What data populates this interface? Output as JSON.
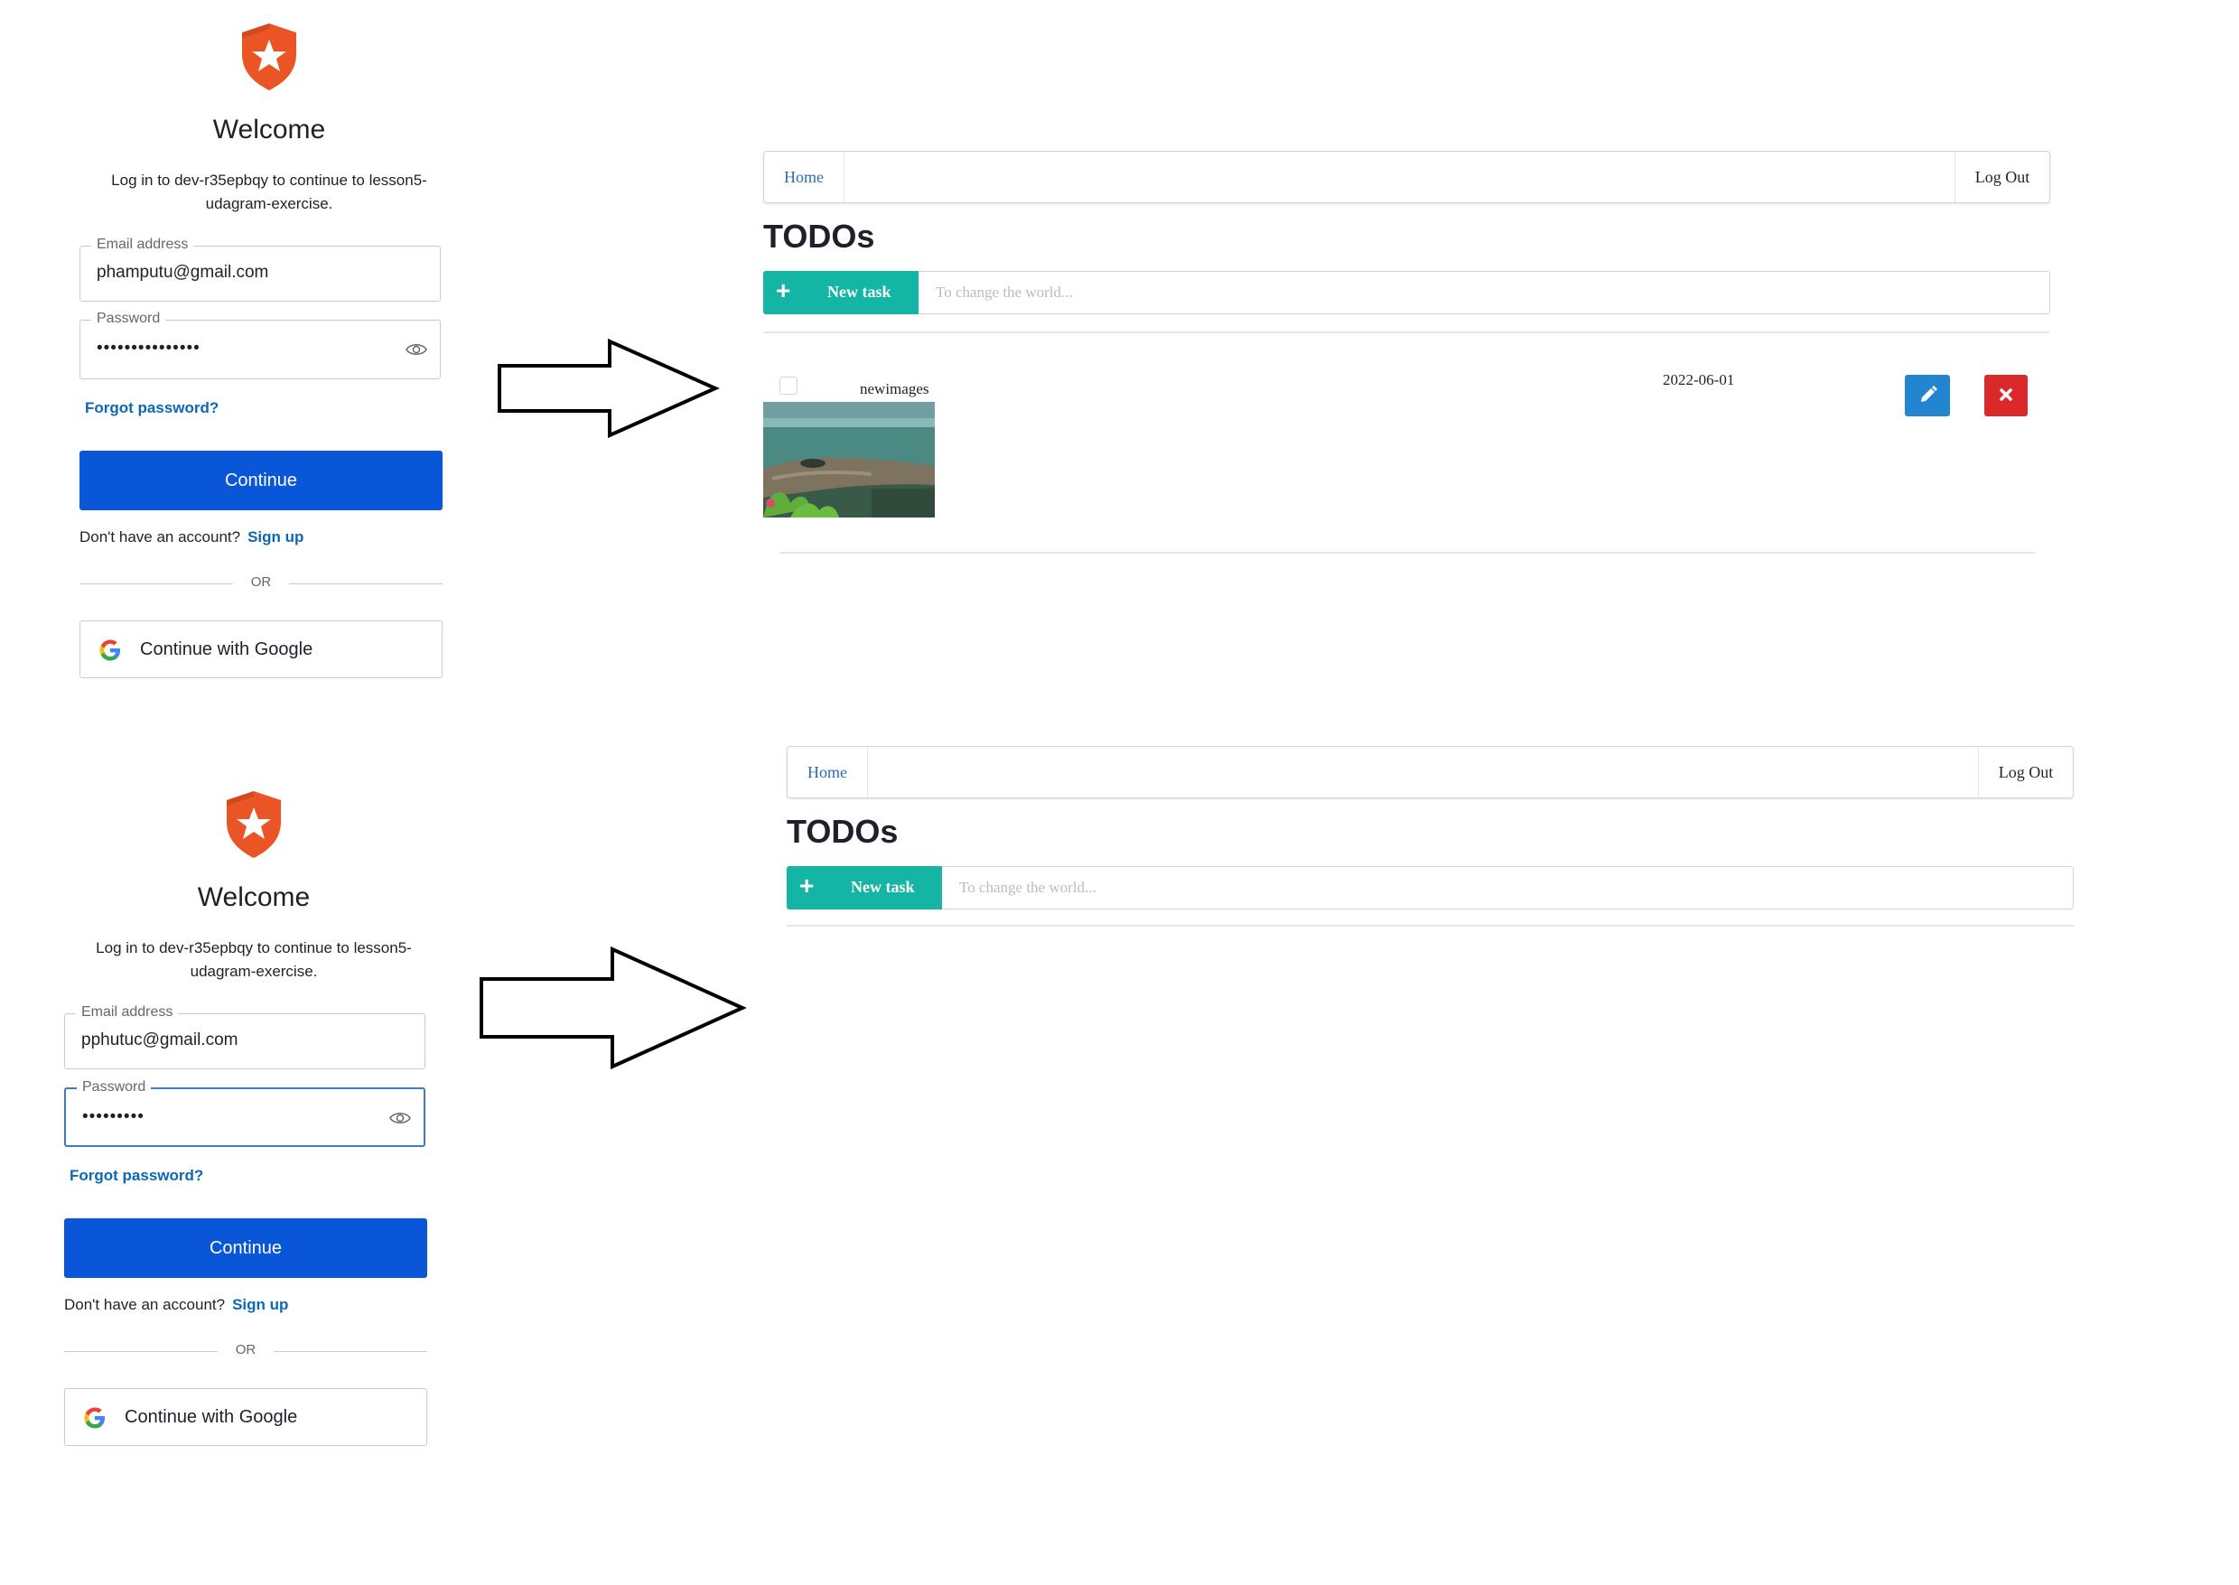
{
  "login_top": {
    "welcome": "Welcome",
    "subtitle": "Log in to dev-r35epbqy to continue to lesson5-udagram-exercise.",
    "email_label": "Email address",
    "email_value": "phamputu@gmail.com",
    "password_label": "Password",
    "password_value": "•••••••••••••••",
    "forgot": "Forgot password?",
    "continue": "Continue",
    "no_account": "Don't have an account?",
    "signup": "Sign up",
    "or": "OR",
    "google": "Continue with Google"
  },
  "login_bottom": {
    "welcome": "Welcome",
    "subtitle": "Log in to dev-r35epbqy to continue to lesson5-udagram-exercise.",
    "email_label": "Email address",
    "email_value": "pphutuc@gmail.com",
    "password_label": "Password",
    "password_value": "•••••••••",
    "forgot": "Forgot password?",
    "continue": "Continue",
    "no_account": "Don't have an account?",
    "signup": "Sign up",
    "or": "OR",
    "google": "Continue with Google"
  },
  "app_top": {
    "nav_home": "Home",
    "nav_logout": "Log Out",
    "title": "TODOs",
    "new_task_label": "New task",
    "new_task_placeholder": "To change the world...",
    "todos": [
      {
        "name": "newimages",
        "due_date": "2022-06-01",
        "done": false
      }
    ]
  },
  "app_bottom": {
    "nav_home": "Home",
    "nav_logout": "Log Out",
    "title": "TODOs",
    "new_task_label": "New task",
    "new_task_placeholder": "To change the world..."
  },
  "colors": {
    "brand_orange": "#eb5424",
    "continue_blue": "#0a56d9",
    "link_blue": "#0a68b5",
    "teal": "#14b5a5",
    "edit_blue": "#2185d0",
    "delete_red": "#db2828"
  },
  "icons": [
    "auth0-shield-logo-icon",
    "eye-icon",
    "google-g-icon",
    "plus-icon",
    "pencil-icon",
    "close-x-icon",
    "arrow-right-icon"
  ]
}
